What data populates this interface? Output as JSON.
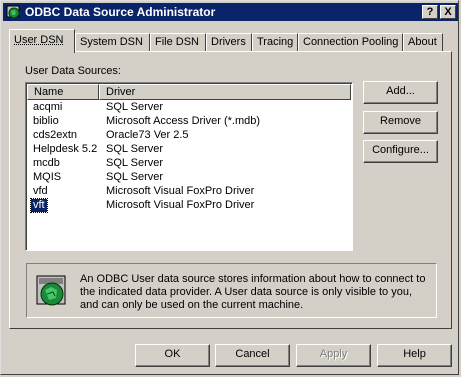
{
  "window": {
    "title": "ODBC Data Source Administrator",
    "help_button": "?",
    "close_button": "X"
  },
  "tabs": [
    {
      "label": "User DSN",
      "active": true
    },
    {
      "label": "System DSN",
      "active": false
    },
    {
      "label": "File DSN",
      "active": false
    },
    {
      "label": "Drivers",
      "active": false
    },
    {
      "label": "Tracing",
      "active": false
    },
    {
      "label": "Connection Pooling",
      "active": false
    },
    {
      "label": "About",
      "active": false
    }
  ],
  "user_sources": {
    "label": "User Data Sources:",
    "columns": [
      "Name",
      "Driver"
    ],
    "rows": [
      {
        "name": "acqmi",
        "driver": "SQL Server"
      },
      {
        "name": "biblio",
        "driver": "Microsoft Access Driver (*.mdb)"
      },
      {
        "name": "cds2extn",
        "driver": "Oracle73 Ver 2.5"
      },
      {
        "name": "Helpdesk 5.2",
        "driver": "SQL Server"
      },
      {
        "name": "mcdb",
        "driver": "SQL Server"
      },
      {
        "name": "MQIS",
        "driver": "SQL Server"
      },
      {
        "name": "vfd",
        "driver": "Microsoft Visual FoxPro Driver"
      },
      {
        "name": "vft",
        "driver": "Microsoft Visual FoxPro Driver",
        "selected": true
      }
    ]
  },
  "side_buttons": {
    "add": "Add...",
    "remove": "Remove",
    "configure": "Configure..."
  },
  "info": {
    "text": "An ODBC User data source stores information about how to connect to the indicated data provider.  A User data source is only visible to you, and can only be used on the current machine."
  },
  "footer_buttons": {
    "ok": "OK",
    "cancel": "Cancel",
    "apply": "Apply",
    "help": "Help"
  },
  "colors": {
    "titlebar": "#0a246a",
    "face": "#d4d0c8",
    "selection": "#0a246a"
  }
}
